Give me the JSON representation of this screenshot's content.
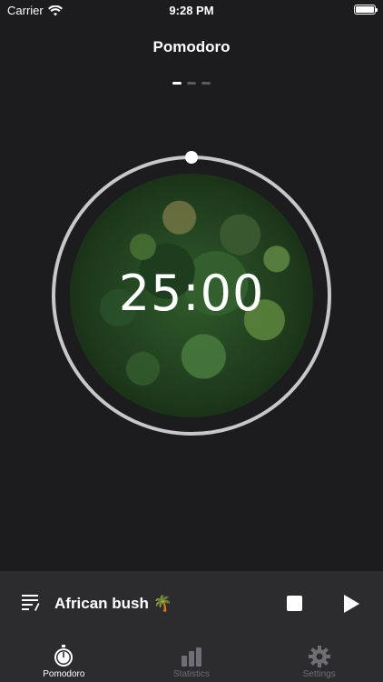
{
  "status_bar": {
    "carrier": "Carrier",
    "time": "9:28 PM"
  },
  "screen": {
    "title": "Pomodoro"
  },
  "pager": {
    "pages": 3,
    "active": 0
  },
  "timer": {
    "time": "25:00",
    "progress": 1.0,
    "image": "forest-aerial"
  },
  "player": {
    "playlist_icon": "playlist-icon",
    "track_name": "African bush 🌴",
    "stop_icon": "stop-icon",
    "play_icon": "play-icon"
  },
  "tabs": [
    {
      "label": "Pomodoro",
      "icon": "stopwatch-icon",
      "active": true
    },
    {
      "label": "Statistics",
      "icon": "bar-chart-icon",
      "active": false
    },
    {
      "label": "Settings",
      "icon": "gear-icon",
      "active": false
    }
  ],
  "colors": {
    "background": "#1c1c1e",
    "panel": "#2c2c2e",
    "ring": "#c8c8c8",
    "inactive": "#6e6e73"
  }
}
